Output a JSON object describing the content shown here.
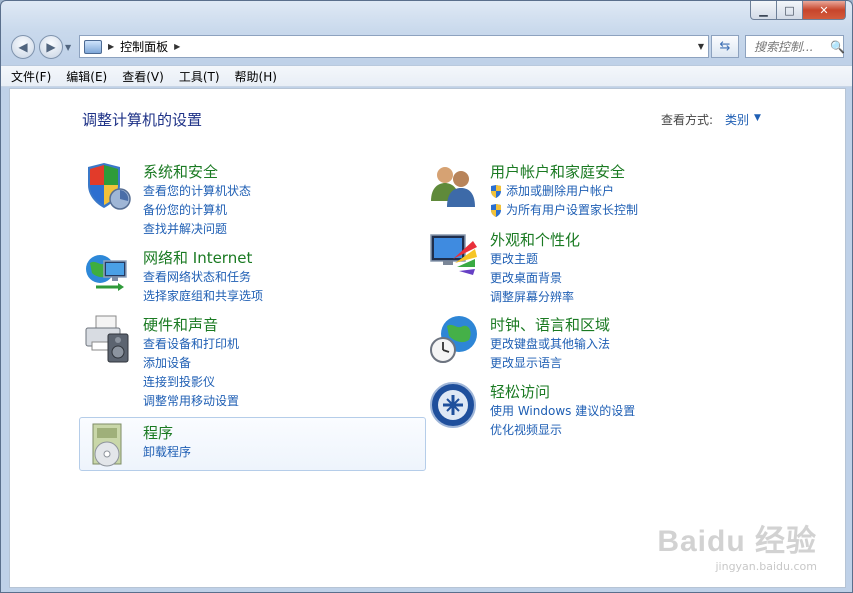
{
  "titlebar": {
    "minimize": "▁",
    "maximize": "□",
    "close": "✕"
  },
  "nav": {
    "back_icon": "back-arrow-icon",
    "forward_icon": "forward-arrow-icon",
    "breadcrumb": "控制面板",
    "search_placeholder": "搜索控制..."
  },
  "menu": [
    "文件(F)",
    "编辑(E)",
    "查看(V)",
    "工具(T)",
    "帮助(H)"
  ],
  "main": {
    "title": "调整计算机的设置",
    "view_by_label": "查看方式:",
    "view_by_value": "类别"
  },
  "categories": {
    "system": {
      "title": "系统和安全",
      "icon": "shield-security-icon",
      "links": [
        "查看您的计算机状态",
        "备份您的计算机",
        "查找并解决问题"
      ]
    },
    "network": {
      "title": "网络和 Internet",
      "icon": "network-globe-icon",
      "links": [
        "查看网络状态和任务",
        "选择家庭组和共享选项"
      ]
    },
    "hardware": {
      "title": "硬件和声音",
      "icon": "printer-speaker-icon",
      "links": [
        "查看设备和打印机",
        "添加设备",
        "连接到投影仪",
        "调整常用移动设置"
      ]
    },
    "programs": {
      "title": "程序",
      "icon": "programs-disc-icon",
      "links": [
        "卸载程序"
      ]
    },
    "users": {
      "title": "用户帐户和家庭安全",
      "icon": "users-icon",
      "links": [
        "添加或删除用户帐户",
        "为所有用户设置家长控制"
      ]
    },
    "appearance": {
      "title": "外观和个性化",
      "icon": "monitor-palette-icon",
      "links": [
        "更改主题",
        "更改桌面背景",
        "调整屏幕分辨率"
      ]
    },
    "clock": {
      "title": "时钟、语言和区域",
      "icon": "clock-globe-icon",
      "links": [
        "更改键盘或其他输入法",
        "更改显示语言"
      ]
    },
    "ease": {
      "title": "轻松访问",
      "icon": "ease-of-access-icon",
      "links": [
        "使用 Windows 建议的设置",
        "优化视频显示"
      ]
    }
  },
  "watermark": {
    "logo": "Baidu 经验",
    "url": "jingyan.baidu.com"
  }
}
